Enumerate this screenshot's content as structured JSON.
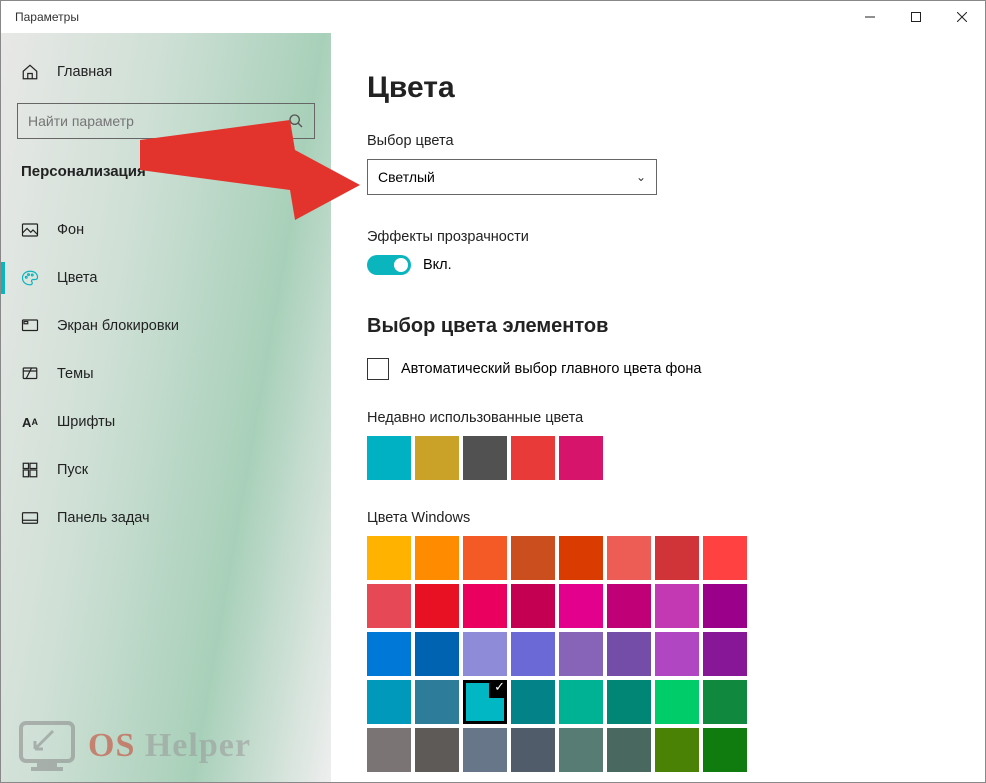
{
  "titlebar": {
    "title": "Параметры"
  },
  "sidebar": {
    "home": "Главная",
    "search_placeholder": "Найти параметр",
    "section": "Персонализация",
    "items": [
      {
        "label": "Фон"
      },
      {
        "label": "Цвета"
      },
      {
        "label": "Экран блокировки"
      },
      {
        "label": "Темы"
      },
      {
        "label": "Шрифты"
      },
      {
        "label": "Пуск"
      },
      {
        "label": "Панель задач"
      }
    ]
  },
  "content": {
    "title": "Цвета",
    "color_mode_label": "Выбор цвета",
    "color_mode_value": "Светлый",
    "transparency_label": "Эффекты прозрачности",
    "transparency_state": "Вкл.",
    "accent_heading": "Выбор цвета элементов",
    "auto_checkbox_label": "Автоматический выбор главного цвета фона",
    "recent_label": "Недавно использованные цвета",
    "recent_colors": [
      "#00b1c4",
      "#c9a227",
      "#515151",
      "#e93a3a",
      "#d6146b"
    ],
    "windows_label": "Цвета Windows",
    "windows_colors": [
      [
        "#ffb300",
        "#ff8c00",
        "#f45a26",
        "#cb4f1e",
        "#da3b01",
        "#ee5d55",
        "#d13438",
        "#ff4141"
      ],
      [
        "#e74856",
        "#e81123",
        "#ea005e",
        "#c30052",
        "#e3008c",
        "#bf0077",
        "#c239b3",
        "#9a0089"
      ],
      [
        "#0078d7",
        "#0063b1",
        "#8e8cd8",
        "#6b69d6",
        "#8764b8",
        "#744da9",
        "#b146c2",
        "#881798"
      ],
      [
        "#0099bc",
        "#2d7d9a",
        "#00b7c3",
        "#038387",
        "#00b294",
        "#018574",
        "#00cc6a",
        "#10893e"
      ],
      [
        "#7a7574",
        "#5d5a58",
        "#68768a",
        "#515c6b",
        "#567c73",
        "#486860",
        "#498205",
        "#107c10"
      ]
    ],
    "selected_color": {
      "row": 3,
      "col": 2
    }
  },
  "watermark": {
    "t1": "OS",
    "t2": " Helper"
  }
}
